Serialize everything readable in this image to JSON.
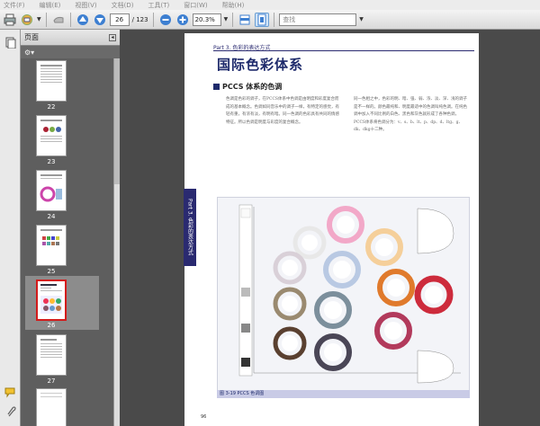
{
  "menubar": {
    "items": [
      "文件(F)",
      "编辑(E)",
      "视图(V)",
      "文档(D)",
      "工具(T)",
      "窗口(W)",
      "帮助(H)"
    ]
  },
  "toolbar": {
    "current_page": "26",
    "total_pages": "/ 123",
    "zoom": "20.3%",
    "search_placeholder": "查找"
  },
  "panel": {
    "title": "页面",
    "thumbnails": [
      {
        "label": "22"
      },
      {
        "label": "23"
      },
      {
        "label": "24"
      },
      {
        "label": "25"
      },
      {
        "label": "26"
      },
      {
        "label": "27"
      },
      {
        "label": "28"
      }
    ],
    "selected_index": 4
  },
  "page": {
    "part_header": "Part 3. 色彩的表达方式",
    "title": "国际色彩体系",
    "section_title": "PCCS 体系的色调",
    "side_tab": "Part 3. 色彩的表达方式",
    "figure_caption": "图 3-19 PCCS 色调图",
    "page_number": "96",
    "col1": "色调是色彩的调子，在PCCS体系中色调是由明度和彩度复合而成的基本概念。色调如同音乐中的调子一样，有特定的感觉，有轻有重，有浓有淡，有明有暗。同一色调的色彩具有共同的情感特征。所以色调是明度与彩度的复合概念。",
    "col2": "同一色相之中，色彩的明、暗、强、弱、浓、淡、深、浅的调子是不一样的。颜色最纯和、明度最适中的色调叫纯色调。在纯色调中加入不同比例的白色、黑色和灰色就形成了各种色调，PCCS体系将色调分为：v、s、b、lt、p、dp、d、ltg、g、dk、dkg十二种。"
  },
  "colors": {
    "accent_navy": "#1e2a6b",
    "selection_red": "#d31b1b",
    "panel_bg": "#5e5e5e",
    "doc_bg": "#4a4a4a"
  }
}
